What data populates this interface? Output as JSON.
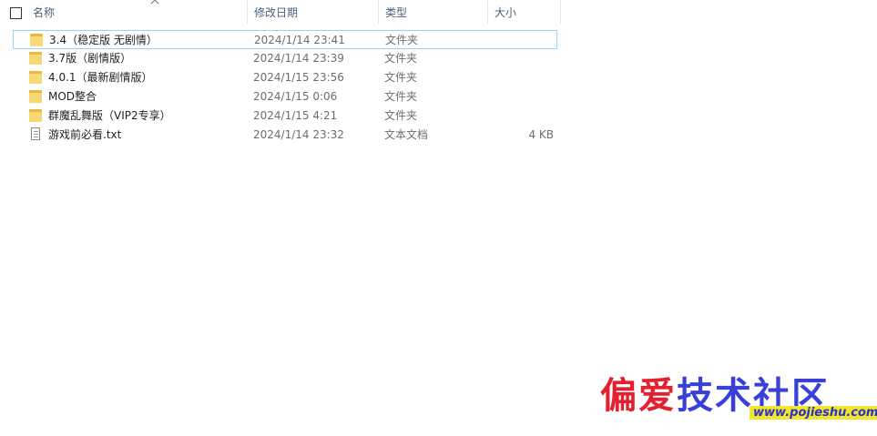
{
  "columns": {
    "name": "名称",
    "date": "修改日期",
    "type": "类型",
    "size": "大小"
  },
  "files": [
    {
      "name": "3.4（稳定版 无剧情）",
      "date": "2024/1/14 23:41",
      "type": "文件夹",
      "size": "",
      "icon": "folder-icon"
    },
    {
      "name": "3.7版（剧情版）",
      "date": "2024/1/14 23:39",
      "type": "文件夹",
      "size": "",
      "icon": "folder-icon"
    },
    {
      "name": "4.0.1（最新剧情版）",
      "date": "2024/1/15 23:56",
      "type": "文件夹",
      "size": "",
      "icon": "folder-icon"
    },
    {
      "name": "MOD整合",
      "date": "2024/1/15 0:06",
      "type": "文件夹",
      "size": "",
      "icon": "folder-icon"
    },
    {
      "name": "群魔乱舞版（VIP2专享）",
      "date": "2024/1/15 4:21",
      "type": "文件夹",
      "size": "",
      "icon": "folder-icon"
    },
    {
      "name": "游戏前必看.txt",
      "date": "2024/1/14 23:32",
      "type": "文本文档",
      "size": "4 KB",
      "icon": "text-file-icon"
    }
  ],
  "watermark": {
    "text_part1": "偏爱",
    "text_part2": "技术社区",
    "url": "www.pojieshu.com",
    "colors": {
      "part1": "#e5202e",
      "part2": "#3a3fd8"
    }
  }
}
